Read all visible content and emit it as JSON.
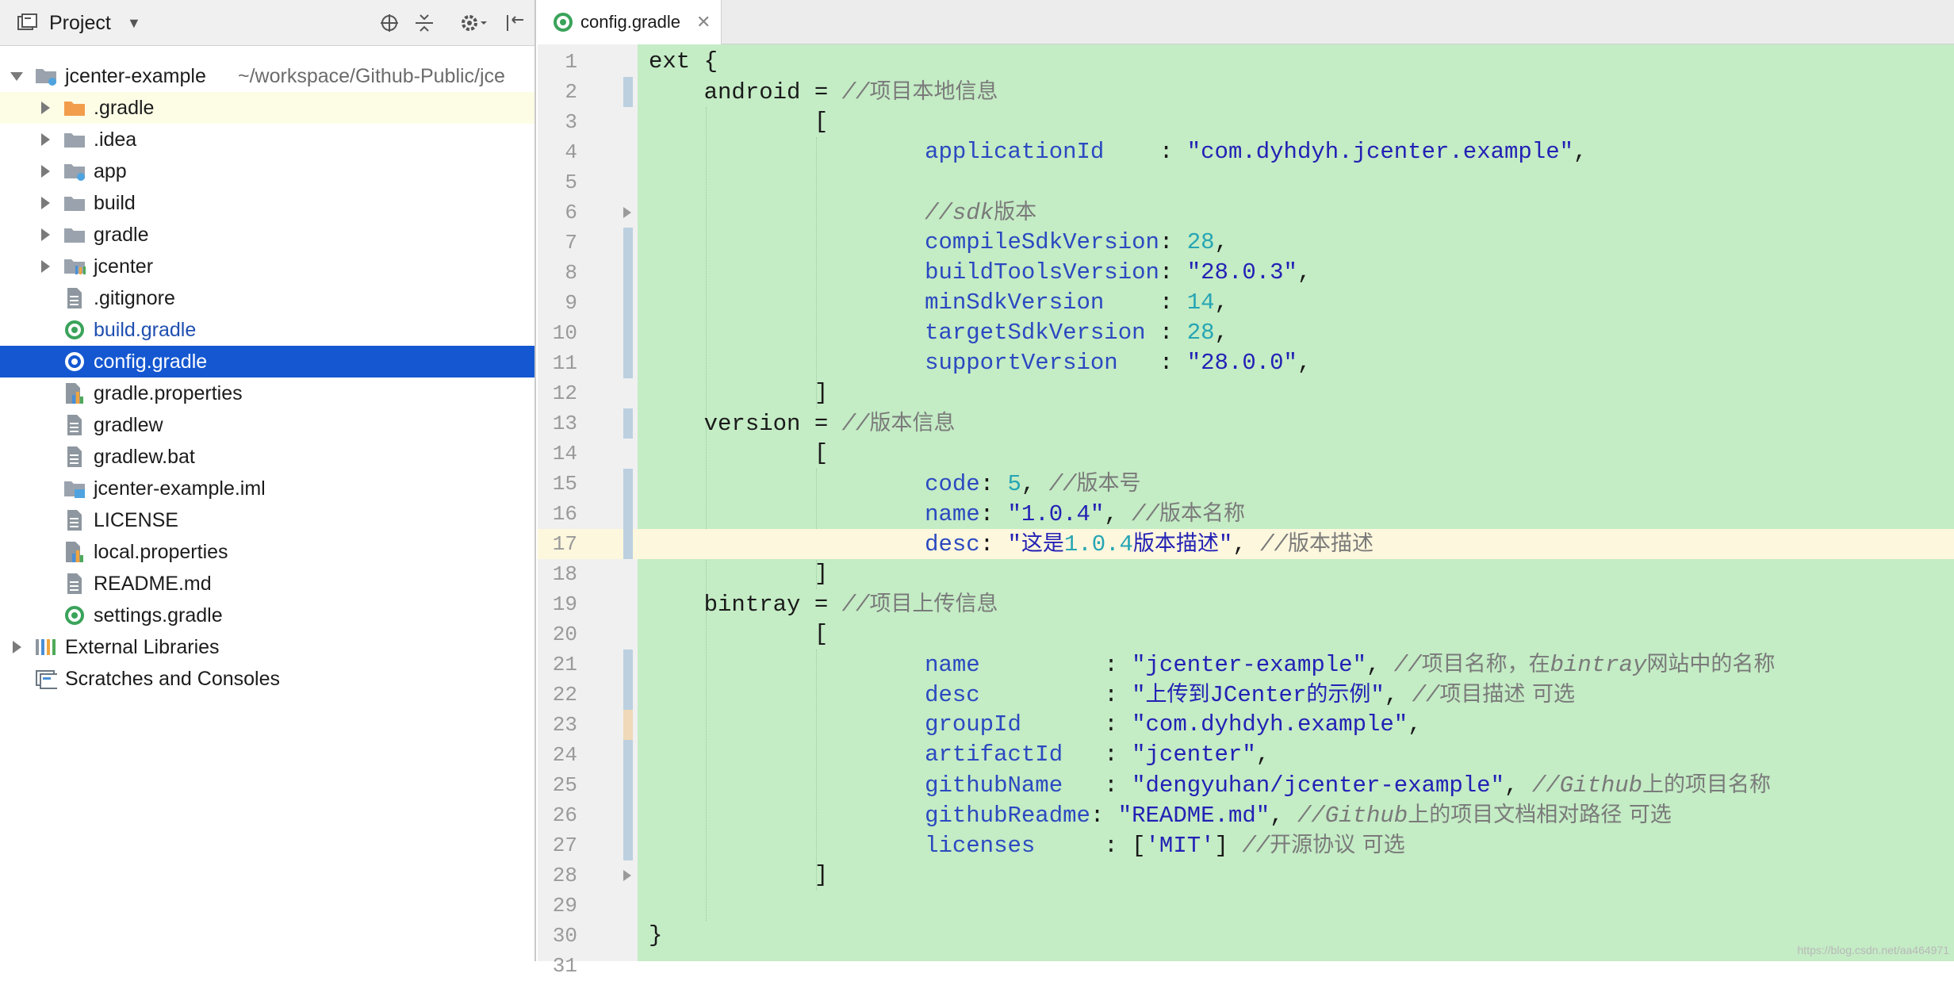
{
  "project_panel": {
    "title": "Project",
    "tree": [
      {
        "label": "jcenter-example",
        "hint": "~/workspace/Github-Public/jce",
        "icon": "module-folder-icon",
        "depth": 0,
        "arrow": "down"
      },
      {
        "label": ".gradle",
        "icon": "folder-orange-icon",
        "depth": 1,
        "arrow": "right",
        "highlight": "yellow"
      },
      {
        "label": ".idea",
        "icon": "folder-icon",
        "depth": 1,
        "arrow": "right"
      },
      {
        "label": "app",
        "icon": "module-folder-icon",
        "depth": 1,
        "arrow": "right"
      },
      {
        "label": "build",
        "icon": "folder-icon",
        "depth": 1,
        "arrow": "right"
      },
      {
        "label": "gradle",
        "icon": "folder-icon",
        "depth": 1,
        "arrow": "right"
      },
      {
        "label": "jcenter",
        "icon": "library-folder-icon",
        "depth": 1,
        "arrow": "right"
      },
      {
        "label": ".gitignore",
        "icon": "text-file-icon",
        "depth": 1
      },
      {
        "label": "build.gradle",
        "icon": "gradle-file-icon",
        "depth": 1,
        "color": "#1f4fb0"
      },
      {
        "label": "config.gradle",
        "icon": "gradle-file-icon",
        "depth": 1,
        "selected": true
      },
      {
        "label": "gradle.properties",
        "icon": "properties-file-icon",
        "depth": 1
      },
      {
        "label": "gradlew",
        "icon": "text-file-icon",
        "depth": 1
      },
      {
        "label": "gradlew.bat",
        "icon": "text-file-icon",
        "depth": 1
      },
      {
        "label": "jcenter-example.iml",
        "icon": "iml-file-icon",
        "depth": 1
      },
      {
        "label": "LICENSE",
        "icon": "text-file-icon",
        "depth": 1
      },
      {
        "label": "local.properties",
        "icon": "properties-file-icon",
        "depth": 1
      },
      {
        "label": "README.md",
        "icon": "text-file-icon",
        "depth": 1
      },
      {
        "label": "settings.gradle",
        "icon": "gradle-file-icon",
        "depth": 1
      },
      {
        "label": "External Libraries",
        "icon": "external-libraries-icon",
        "depth": 0,
        "arrow": "right"
      },
      {
        "label": "Scratches and Consoles",
        "icon": "scratches-icon",
        "depth": 0
      }
    ]
  },
  "editor": {
    "tab_label": "config.gradle",
    "current_line": 17,
    "lines": [
      [
        [
          "t",
          "ext {"
        ]
      ],
      [
        [
          "t",
          "    android = "
        ],
        [
          "com",
          "//"
        ],
        [
          "cn",
          "项目本地信息"
        ]
      ],
      [
        [
          "t",
          "            ["
        ]
      ],
      [
        [
          "t",
          "                    "
        ],
        [
          "prop",
          "applicationId"
        ],
        [
          "t",
          "    : "
        ],
        [
          "str",
          "\"com.dyhdyh.jcenter.example\""
        ],
        [
          "t",
          ","
        ]
      ],
      [
        [
          "t",
          ""
        ]
      ],
      [
        [
          "t",
          "                    "
        ],
        [
          "com",
          "//sdk"
        ],
        [
          "cn",
          "版本"
        ]
      ],
      [
        [
          "t",
          "                    "
        ],
        [
          "prop",
          "compileSdkVersion"
        ],
        [
          "t",
          ": "
        ],
        [
          "num",
          "28"
        ],
        [
          "t",
          ","
        ]
      ],
      [
        [
          "t",
          "                    "
        ],
        [
          "prop",
          "buildToolsVersion"
        ],
        [
          "t",
          ": "
        ],
        [
          "str",
          "\"28.0.3\""
        ],
        [
          "t",
          ","
        ]
      ],
      [
        [
          "t",
          "                    "
        ],
        [
          "prop",
          "minSdkVersion"
        ],
        [
          "t",
          "    : "
        ],
        [
          "num",
          "14"
        ],
        [
          "t",
          ","
        ]
      ],
      [
        [
          "t",
          "                    "
        ],
        [
          "prop",
          "targetSdkVersion"
        ],
        [
          "t",
          " : "
        ],
        [
          "num",
          "28"
        ],
        [
          "t",
          ","
        ]
      ],
      [
        [
          "t",
          "                    "
        ],
        [
          "prop",
          "supportVersion"
        ],
        [
          "t",
          "   : "
        ],
        [
          "str",
          "\"28.0.0\""
        ],
        [
          "t",
          ","
        ]
      ],
      [
        [
          "t",
          "            ]"
        ]
      ],
      [
        [
          "t",
          "    version = "
        ],
        [
          "com",
          "//"
        ],
        [
          "cn",
          "版本信息"
        ]
      ],
      [
        [
          "t",
          "            ["
        ]
      ],
      [
        [
          "t",
          "                    "
        ],
        [
          "prop",
          "code"
        ],
        [
          "t",
          ": "
        ],
        [
          "num",
          "5"
        ],
        [
          "t",
          ", "
        ],
        [
          "com",
          "//"
        ],
        [
          "cn",
          "版本号"
        ]
      ],
      [
        [
          "t",
          "                    "
        ],
        [
          "prop",
          "name"
        ],
        [
          "t",
          ": "
        ],
        [
          "str",
          "\"1.0.4\""
        ],
        [
          "t",
          ", "
        ],
        [
          "com",
          "//"
        ],
        [
          "cn",
          "版本名称"
        ]
      ],
      [
        [
          "t",
          "                    "
        ],
        [
          "prop",
          "desc"
        ],
        [
          "t",
          ": "
        ],
        [
          "str",
          "\""
        ],
        [
          "sn",
          "这是"
        ],
        [
          "num",
          "1.0.4"
        ],
        [
          "sn",
          "版本描述"
        ],
        [
          "str",
          "\""
        ],
        [
          "t",
          ", "
        ],
        [
          "com",
          "//"
        ],
        [
          "cn",
          "版本描述"
        ]
      ],
      [
        [
          "t",
          "            ]"
        ]
      ],
      [
        [
          "t",
          "    bintray = "
        ],
        [
          "com",
          "//"
        ],
        [
          "cn",
          "项目上传信息"
        ]
      ],
      [
        [
          "t",
          "            ["
        ]
      ],
      [
        [
          "t",
          "                    "
        ],
        [
          "prop",
          "name"
        ],
        [
          "t",
          "         : "
        ],
        [
          "str",
          "\"jcenter-example\""
        ],
        [
          "t",
          ", "
        ],
        [
          "com",
          "//"
        ],
        [
          "cn",
          "项目名称，在"
        ],
        [
          "com",
          "bintray"
        ],
        [
          "cn",
          "网站中的名称"
        ]
      ],
      [
        [
          "t",
          "                    "
        ],
        [
          "prop",
          "desc"
        ],
        [
          "t",
          "         : "
        ],
        [
          "str",
          "\""
        ],
        [
          "sn",
          "上传到"
        ],
        [
          "str",
          "JCenter"
        ],
        [
          "sn",
          "的示例"
        ],
        [
          "str",
          "\""
        ],
        [
          "t",
          ", "
        ],
        [
          "com",
          "//"
        ],
        [
          "cn",
          "项目描述 可选"
        ]
      ],
      [
        [
          "t",
          "                    "
        ],
        [
          "prop",
          "groupId"
        ],
        [
          "t",
          "      : "
        ],
        [
          "str",
          "\"com.dyhdyh.example\""
        ],
        [
          "t",
          ","
        ]
      ],
      [
        [
          "t",
          "                    "
        ],
        [
          "prop",
          "artifactId"
        ],
        [
          "t",
          "   : "
        ],
        [
          "str",
          "\"jcenter\""
        ],
        [
          "t",
          ","
        ]
      ],
      [
        [
          "t",
          "                    "
        ],
        [
          "prop",
          "githubName"
        ],
        [
          "t",
          "   : "
        ],
        [
          "str",
          "\"dengyuhan/jcenter-example\""
        ],
        [
          "t",
          ", "
        ],
        [
          "com",
          "//Github"
        ],
        [
          "cn",
          "上的项目名称"
        ]
      ],
      [
        [
          "t",
          "                    "
        ],
        [
          "prop",
          "githubReadme"
        ],
        [
          "t",
          ": "
        ],
        [
          "str",
          "\"README.md\""
        ],
        [
          "t",
          ", "
        ],
        [
          "com",
          "//Github"
        ],
        [
          "cn",
          "上的项目文档相对路径 可选"
        ]
      ],
      [
        [
          "t",
          "                    "
        ],
        [
          "prop",
          "licenses"
        ],
        [
          "t",
          "     : ["
        ],
        [
          "str",
          "'MIT'"
        ],
        [
          "t",
          "] "
        ],
        [
          "com",
          "//"
        ],
        [
          "cn",
          "开源协议 可选"
        ]
      ],
      [
        [
          "t",
          "            ]"
        ]
      ],
      [
        [
          "t",
          ""
        ]
      ],
      [
        [
          "t",
          "}"
        ]
      ],
      [
        [
          "t",
          ""
        ]
      ]
    ]
  },
  "watermark": "https://blog.csdn.net/aa464971"
}
